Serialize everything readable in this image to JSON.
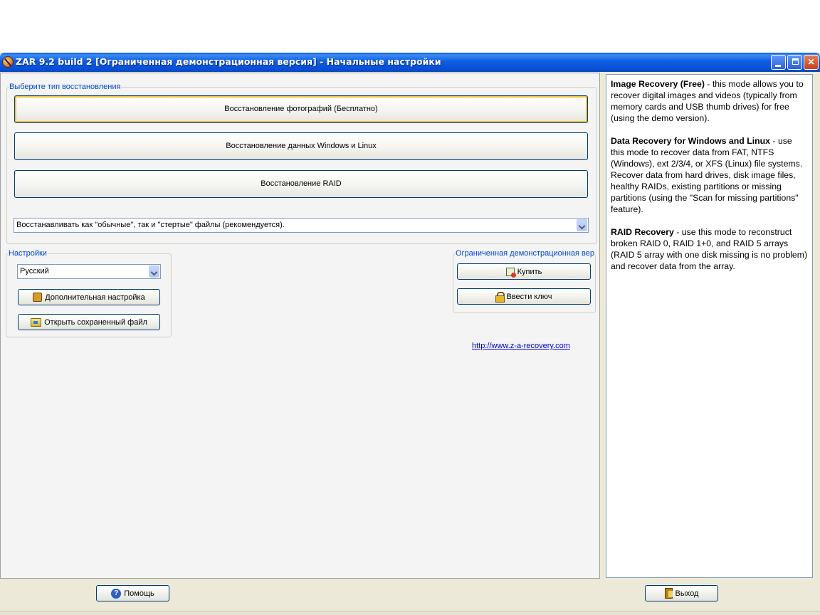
{
  "window": {
    "title": "ZAR 9.2 build 2 [Ограниченная демонстрационная версия] - Начальные настройки",
    "controls": {
      "minimize_icon": "minimize-icon",
      "maximize_icon": "restore-icon",
      "close_icon": "close-icon"
    }
  },
  "recovery_type": {
    "legend": "Выберите тип восстановления",
    "photo_button": "Восстановление фотографий (Бесплатно)",
    "windows_linux_button": "Восстановление данных Windows и Linux",
    "raid_button": "Восстановление RAID",
    "mode_select": "Восстанавливать как \"обычные\", так и \"стертые\" файлы (рекомендуется)."
  },
  "settings": {
    "legend": "Настройки",
    "language": "Русский",
    "advanced_button": "Дополнительная настройка",
    "open_button": "Открыть сохраненный файл"
  },
  "demo": {
    "legend": "Ограниченная демонстрационная вер",
    "buy_button": "Купить",
    "key_button": "Ввести ключ",
    "link": "http://www.z-a-recovery.com"
  },
  "help_panel": {
    "image_title": "Image Recovery (Free)",
    "image_text": " - this mode allows you to recover digital images and videos (typically from memory cards and USB thumb drives) for free (using the demo version).",
    "data_title": "Data Recovery for Windows and Linux",
    "data_text": " - use this mode to recover data from FAT, NTFS (Windows), ext 2/3/4, or XFS (Linux) file systems. Recover data from hard drives, disk image files, healthy RAIDs, existing partitions or missing partitions (using the \"Scan for missing partitions\" feature).",
    "raid_title": "RAID Recovery",
    "raid_text": " - use this mode to reconstruct broken RAID 0, RAID 1+0, and RAID 5 arrays (RAID 5 array with one disk missing is no problem) and recover data from the array."
  },
  "footer": {
    "help_button": "Помощь",
    "exit_button": "Выход"
  },
  "colors": {
    "titlebar": "#0a5fd8",
    "legend_text": "#0046d5",
    "link": "#0000cc",
    "window_bg": "#ece9d8"
  }
}
